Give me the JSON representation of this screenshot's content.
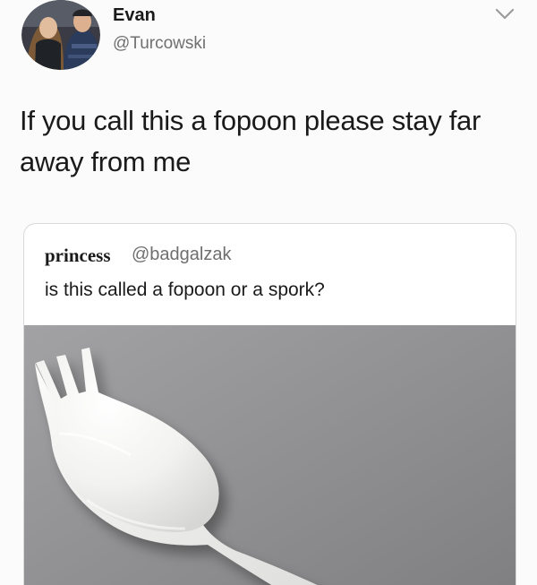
{
  "tweet": {
    "display_name": "Evan",
    "handle": "@Turcowski",
    "text": "If you call this a fopoon please stay far away from me"
  },
  "quoted_tweet": {
    "author_name": "princess",
    "author_handle": "@badgalzak",
    "text": "is this called a fopoon or a spork?",
    "media_icon": "spork-photo"
  },
  "icons": {
    "menu": "chevron-down-icon",
    "avatar": "user-avatar"
  },
  "colors": {
    "text": "#1a1a1a",
    "secondary_text": "#707070",
    "card_border": "#d8d8d8",
    "image_background": "#8d8d8f",
    "utensil": "#f4f4f2"
  }
}
